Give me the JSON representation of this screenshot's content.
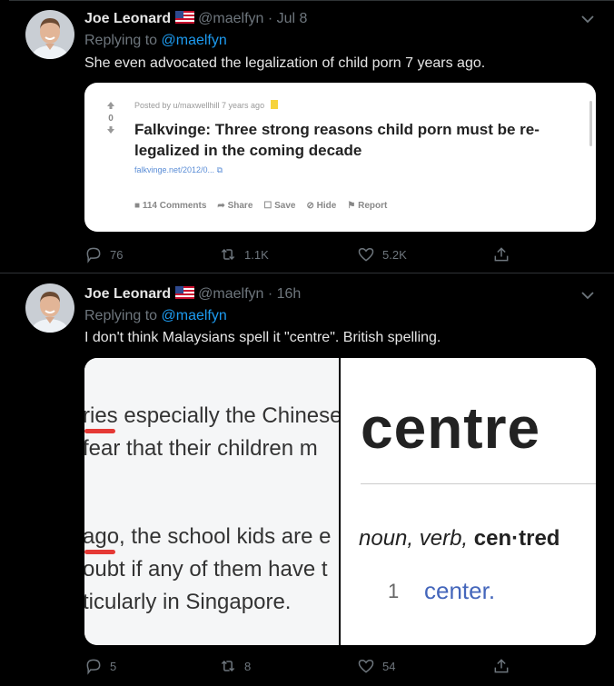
{
  "tweets": [
    {
      "name": "Joe Leonard",
      "handle": "@maelfyn",
      "time": "· Jul 8",
      "replying_prefix": "Replying to",
      "replying_to": "@maelfyn",
      "text": "She even advocated the legalization of child porn 7 years ago.",
      "card": {
        "meta": "Posted by u/maxwellhill 7 years ago",
        "title": "Falkvinge: Three strong reasons child porn must be re-legalized in the coming decade",
        "link": "falkvinge.net/2012/0...",
        "vote_score": "0",
        "bar": [
          "114 Comments",
          "Share",
          "Save",
          "Hide",
          "Report"
        ]
      },
      "actions": {
        "replies": "76",
        "retweets": "1.1K",
        "likes": "5.2K"
      }
    },
    {
      "name": "Joe Leonard",
      "handle": "@maelfyn",
      "time": "· 16h",
      "replying_prefix": "Replying to",
      "replying_to": "@maelfyn",
      "text": "I don't think Malaysians spell it \"centre\". British spelling.",
      "card": {
        "left_lines": [
          "ries especially the Chinese",
          "fear that their children m",
          "ago, the school kids are e",
          "oubt if any of them have t",
          "ticularly in Singapore."
        ],
        "word": "centre",
        "pos_italic": "noun, verb,",
        "pos_bold": "cen·tred",
        "def_num": "1",
        "def_link": "center."
      },
      "actions": {
        "replies": "5",
        "retweets": "8",
        "likes": "54"
      }
    }
  ],
  "colors": {
    "background": "#000000",
    "accent": "#1d9bf0",
    "muted": "#6e767d",
    "divider": "#2f3336"
  },
  "icons": [
    "flag-us-icon",
    "chevron-down-icon",
    "reply-icon",
    "retweet-icon",
    "like-icon",
    "share-icon"
  ]
}
